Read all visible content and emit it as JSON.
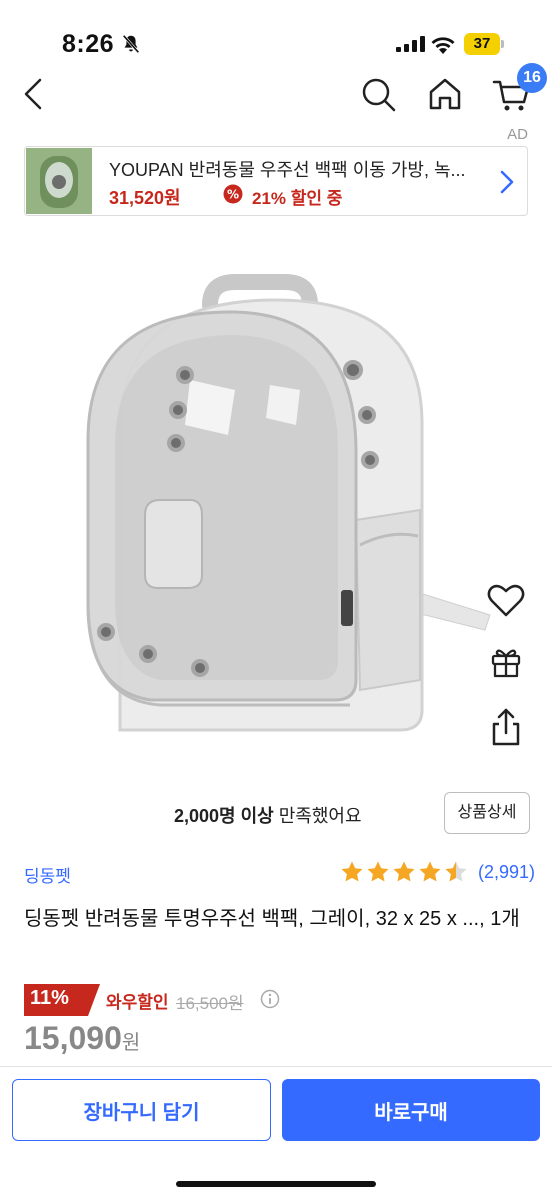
{
  "status_bar": {
    "time": "8:26",
    "battery": "37"
  },
  "nav": {
    "cart_count": "16",
    "ad_label": "AD"
  },
  "ad_banner": {
    "title": "YOUPAN 반려동물 우주선 백팩 이동 가방, 녹...",
    "price": "31,520원",
    "discount": "21% 할인 중"
  },
  "product": {
    "satisfaction_bold": "2,000명 이상",
    "satisfaction_rest": " 만족했어요",
    "detail_button": "상품상세",
    "brand": "딩동펫",
    "rating_stars": 4.5,
    "rating_count": "(2,991)",
    "title": "딩동펫 반려동물 투명우주선 백팩, 그레이, 32 x 25 x ..., 1개",
    "discount_rate": "11%",
    "wow_label": "와우할인",
    "original_price": "16,500원",
    "sale_price": "15,090",
    "sale_unit": "원"
  },
  "bottom": {
    "cart_button": "장바구니 담기",
    "buy_button": "바로구매"
  },
  "colors": {
    "accent": "#346aff",
    "sale_red": "#c7281d",
    "star": "#f5a623"
  }
}
